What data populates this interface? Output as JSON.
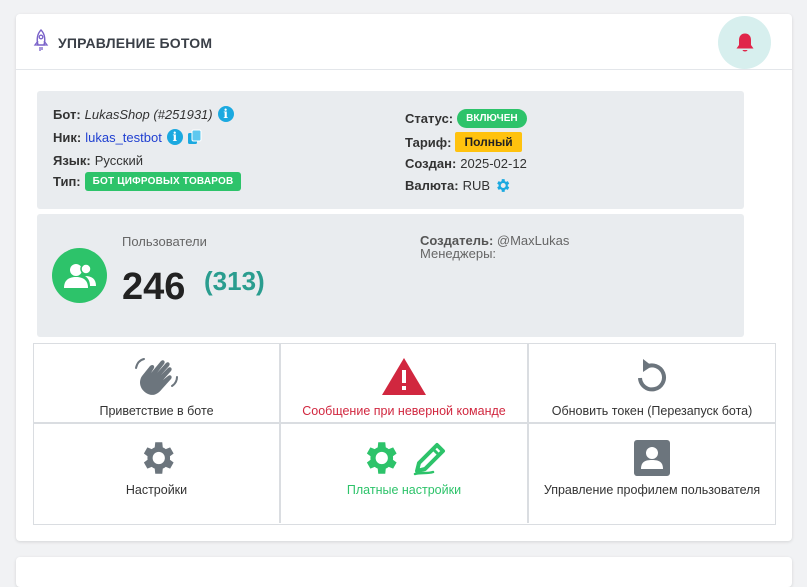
{
  "header": {
    "title": "УПРАВЛЕНИЕ БОТОМ",
    "icon": "rocket-icon",
    "notification_icon": "bell-icon"
  },
  "bot_info": {
    "bot_label": "Бот:",
    "bot_name": "LukasShop (#251931)",
    "nick_label": "Ник:",
    "nick_value": "lukas_testbot",
    "language_label": "Язык:",
    "language_value": "Русский",
    "type_label": "Тип:",
    "type_value": "БОТ ЦИФРОВЫХ ТОВАРОВ",
    "status_label": "Статус:",
    "status_value": "ВКЛЮЧЕН",
    "tariff_label": "Тариф:",
    "tariff_value": "Полный",
    "created_label": "Создан:",
    "created_value": "2025-02-12",
    "currency_label": "Валюта:",
    "currency_value": "RUB"
  },
  "users": {
    "label": "Пользователи",
    "count": "246",
    "total": "(313)",
    "creator_label": "Создатель:",
    "creator_value": "@MaxLukas",
    "managers_label": "Менеджеры:"
  },
  "actions": [
    {
      "label": "Приветствие в боте",
      "icon": "waving-hand-icon"
    },
    {
      "label": "Сообщение при неверной команде",
      "icon": "warning-triangle-icon"
    },
    {
      "label": "Обновить токен (Перезапуск бота)",
      "icon": "refresh-icon"
    },
    {
      "label": "Настройки",
      "icon": "gear-icon"
    },
    {
      "label": "Платные настройки",
      "icon": "gear-pencil-icon"
    },
    {
      "label": "Управление профилем пользователя",
      "icon": "user-profile-icon"
    }
  ],
  "colors": {
    "accent_green": "#2dc36a",
    "warning_red": "#d1273f",
    "tariff_yellow": "#ffc20e",
    "total_teal": "#2a9d8f"
  }
}
